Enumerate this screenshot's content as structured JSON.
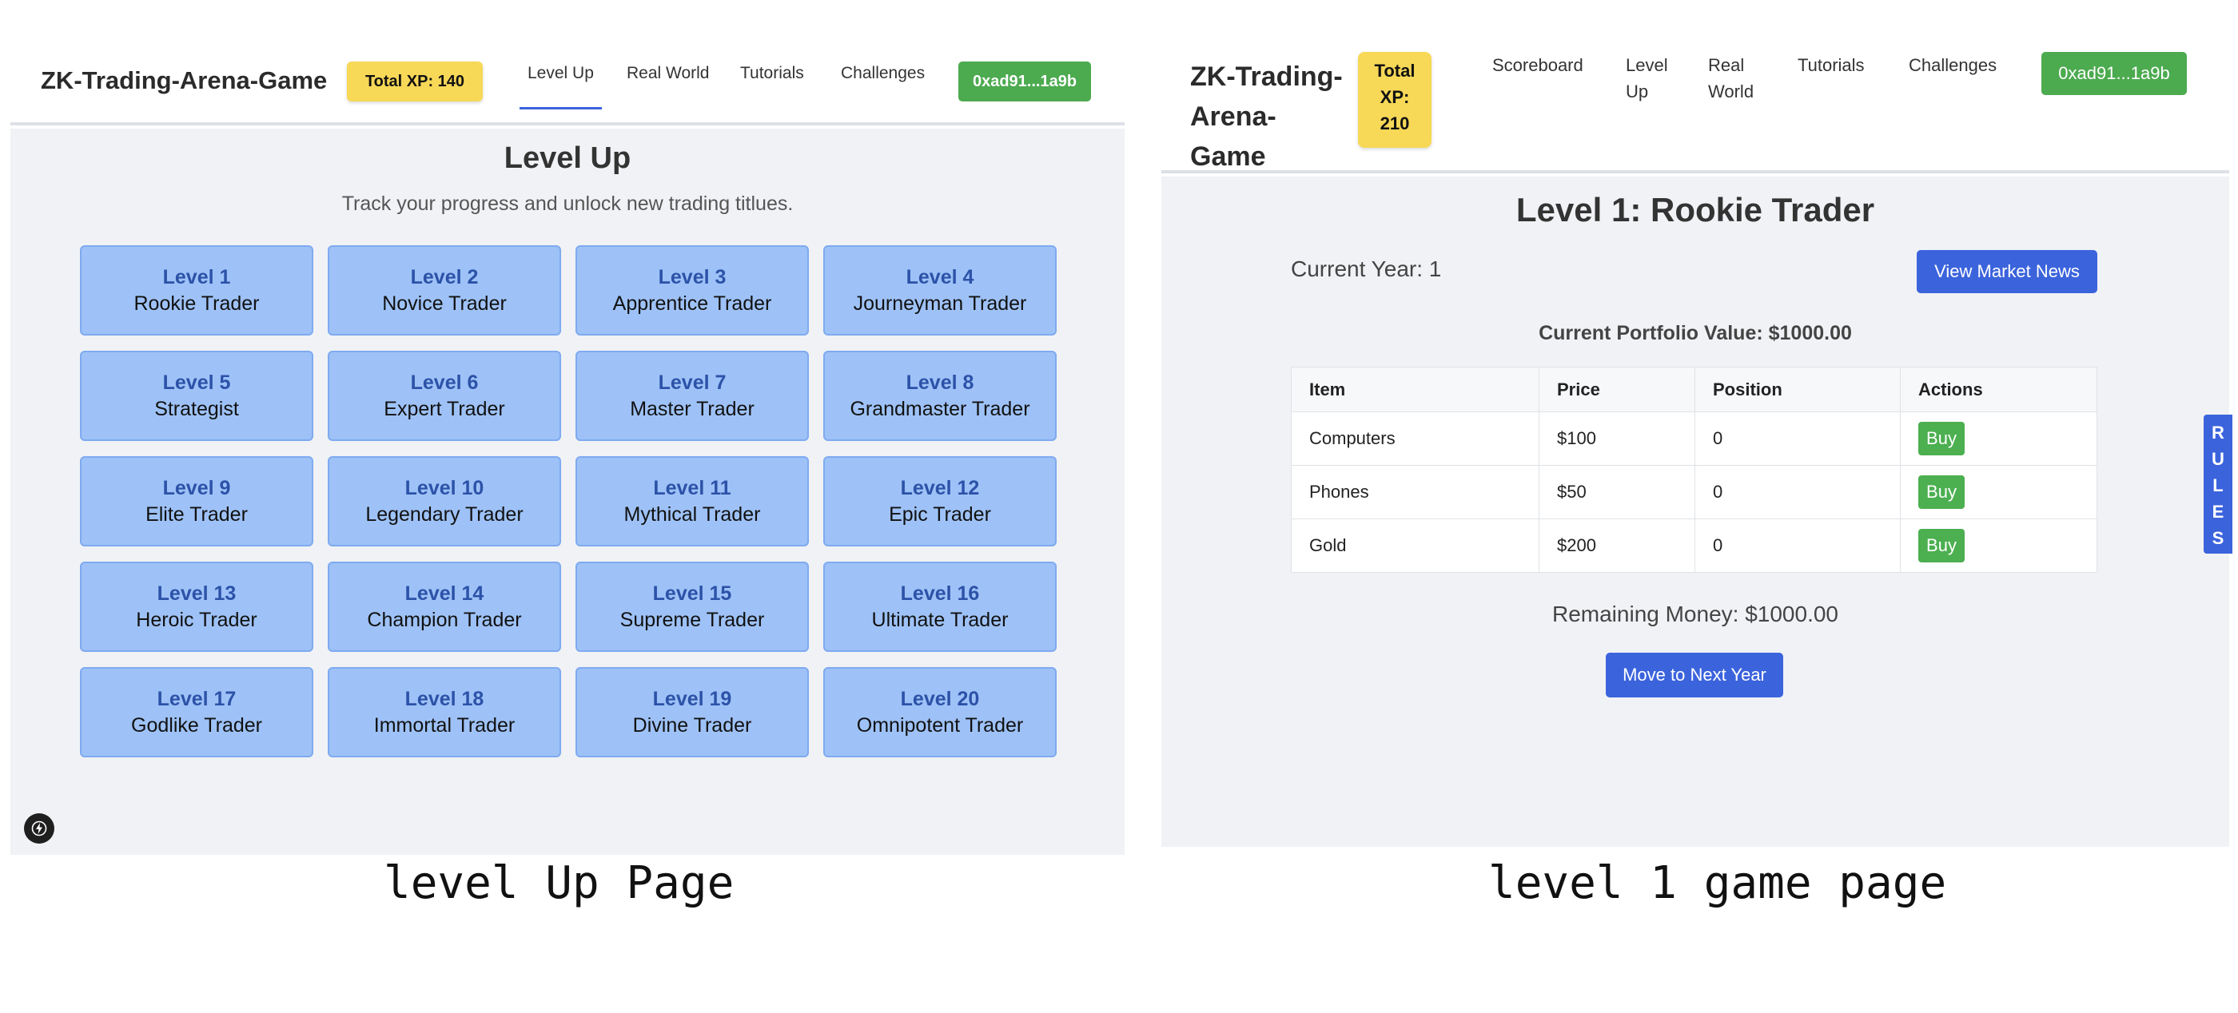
{
  "left_page": {
    "brand": "ZK-Trading-Arena-Game",
    "xp_badge": "Total XP: 140",
    "nav": [
      "Level Up",
      "Real World",
      "Tutorials",
      "Challenges"
    ],
    "active_nav": "Level Up",
    "wallet": "0xad91...1a9b",
    "title": "Level Up",
    "subtitle": "Track your progress and unlock new trading titlues.",
    "levels": [
      {
        "level": "Level 1",
        "name": "Rookie Trader"
      },
      {
        "level": "Level 2",
        "name": "Novice Trader"
      },
      {
        "level": "Level 3",
        "name": "Apprentice Trader"
      },
      {
        "level": "Level 4",
        "name": "Journeyman Trader"
      },
      {
        "level": "Level 5",
        "name": "Strategist"
      },
      {
        "level": "Level 6",
        "name": "Expert Trader"
      },
      {
        "level": "Level 7",
        "name": "Master Trader"
      },
      {
        "level": "Level 8",
        "name": "Grandmaster Trader"
      },
      {
        "level": "Level 9",
        "name": "Elite Trader"
      },
      {
        "level": "Level 10",
        "name": "Legendary Trader"
      },
      {
        "level": "Level 11",
        "name": "Mythical Trader"
      },
      {
        "level": "Level 12",
        "name": "Epic Trader"
      },
      {
        "level": "Level 13",
        "name": "Heroic Trader"
      },
      {
        "level": "Level 14",
        "name": "Champion Trader"
      },
      {
        "level": "Level 15",
        "name": "Supreme Trader"
      },
      {
        "level": "Level 16",
        "name": "Ultimate Trader"
      },
      {
        "level": "Level 17",
        "name": "Godlike Trader"
      },
      {
        "level": "Level 18",
        "name": "Immortal Trader"
      },
      {
        "level": "Level 19",
        "name": "Divine Trader"
      },
      {
        "level": "Level 20",
        "name": "Omnipotent Trader"
      }
    ],
    "fab_icon": "bolt-icon"
  },
  "right_page": {
    "brand_line1": "ZK-Trading-",
    "brand_line2": "Arena-Game",
    "xp_line1": "Total",
    "xp_line2": "XP:",
    "xp_line3": "210",
    "nav": [
      {
        "line1": "Scoreboard",
        "line2": ""
      },
      {
        "line1": "Level",
        "line2": "Up"
      },
      {
        "line1": "Real",
        "line2": "World"
      },
      {
        "line1": "Tutorials",
        "line2": ""
      },
      {
        "line1": "Challenges",
        "line2": ""
      }
    ],
    "wallet": "0xad91...1a9b",
    "title": "Level 1: Rookie Trader",
    "current_year": "Current Year: 1",
    "news_button": "View Market News",
    "portfolio_value": "Current Portfolio Value: $1000.00",
    "table": {
      "headers": [
        "Item",
        "Price",
        "Position",
        "Actions"
      ],
      "rows": [
        {
          "item": "Computers",
          "price": "$100",
          "position": "0",
          "action": "Buy"
        },
        {
          "item": "Phones",
          "price": "$50",
          "position": "0",
          "action": "Buy"
        },
        {
          "item": "Gold",
          "price": "$200",
          "position": "0",
          "action": "Buy"
        }
      ]
    },
    "remaining_money": "Remaining Money: $1000.00",
    "next_year_button": "Move to Next Year",
    "rules_tab": [
      "R",
      "U",
      "L",
      "E",
      "S"
    ]
  },
  "captions": {
    "left": "level Up Page",
    "right": "level 1 game page"
  },
  "colors": {
    "xp_badge": "#f7d857",
    "wallet_green": "#4caa4f",
    "primary_blue": "#3b63dc",
    "level_card": "#9ec2f7",
    "page_bg": "#f0f2f5"
  }
}
